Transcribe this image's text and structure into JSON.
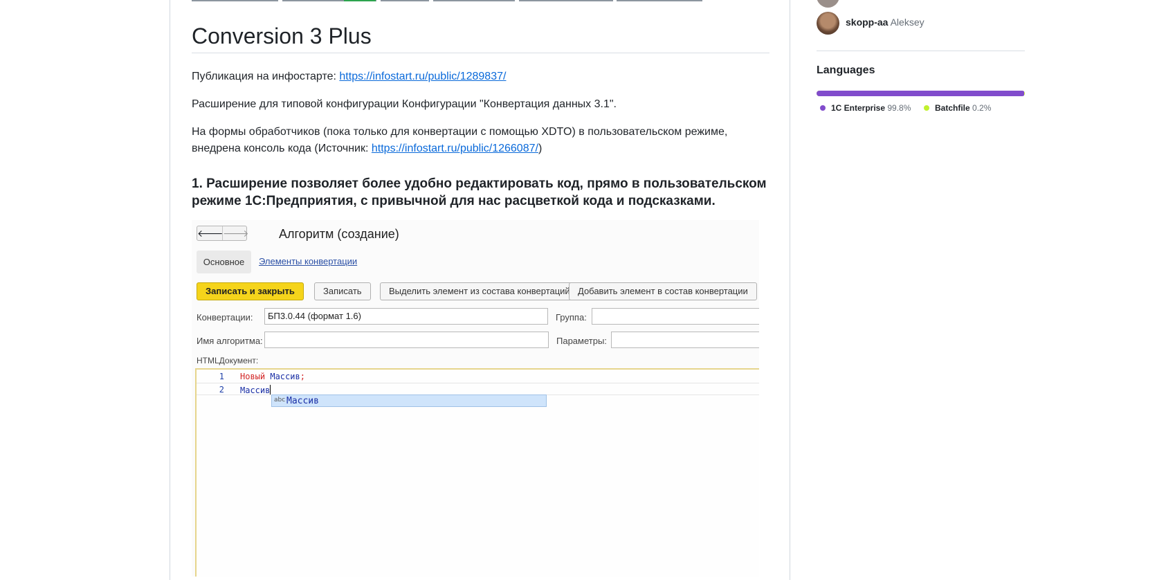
{
  "readme": {
    "title": "Conversion 3 Plus",
    "p1_text": "Публикация на инфостарте: ",
    "p1_link": "https://infostart.ru/public/1289837/",
    "p2_text": "Расширение для типовой конфигурации Конфигурации \"Конвертация данных 3.1\".",
    "p3_text": "На формы обработчиков (пока только для конвертации с помощью XDTO) в пользовательском режиме, внедрена консоль кода (Источник: ",
    "p3_link": "https://infostart.ru/public/1266087/",
    "p3_end": ")",
    "heading": "1. Расширение позволяет более удобно редактировать код, прямо в пользовательском режиме 1С:Предприятия, с привычной для нас расцветкой кода и подсказками."
  },
  "shot": {
    "form_title": "Алгоритм (создание)",
    "tab_main": "Основное",
    "tab_elements": "Элементы конвертации",
    "btn_save_close": "Записать и закрыть",
    "btn_save": "Записать",
    "btn_extract": "Выделить элемент из состава конвертаций",
    "btn_add": "Добавить элемент в состав конвертации",
    "label_conversions": "Конвертации:",
    "value_conversions": "БП3.0.44 (формат 1.6)",
    "label_group": "Группа:",
    "label_name": "Имя алгоритма:",
    "label_params": "Параметры:",
    "label_html": "HTMLДокумент:",
    "line1_no": "1",
    "line1_kw": "Новый",
    "line1_ident": "Массив",
    "line1_end": ";",
    "line2_no": "2",
    "line2_code": "Массив",
    "ac_icon": "abc",
    "ac_item": "Массив"
  },
  "sidebar": {
    "contributor_login": "skopp-aa",
    "contributor_name": "Aleksey",
    "languages_title": "Languages",
    "languages": [
      {
        "name": "1C Enterprise",
        "percent": "99.8%",
        "color": "#814ccc",
        "value": 99.8
      },
      {
        "name": "Batchfile",
        "percent": "0.2%",
        "color": "#c1f12e",
        "value": 0.2
      }
    ]
  }
}
